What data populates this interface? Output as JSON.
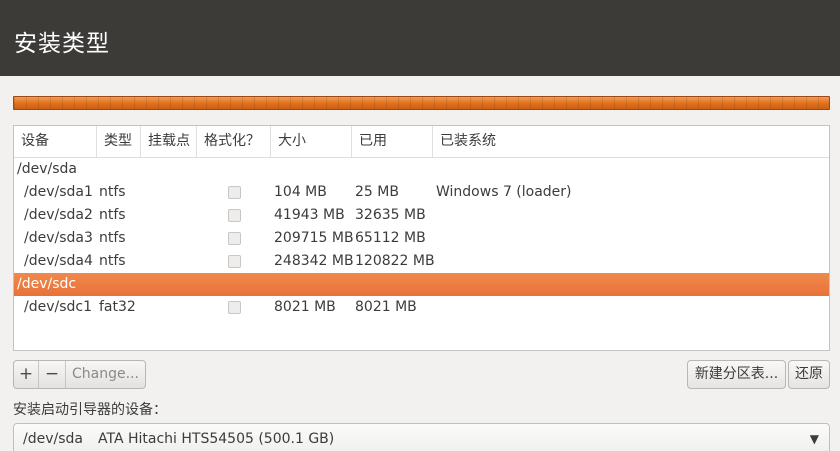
{
  "window": {
    "title": "安装类型"
  },
  "table": {
    "columns": [
      "设备",
      "类型",
      "挂载点",
      "格式化？",
      "大小",
      "已用",
      "已装系统"
    ],
    "rows": [
      {
        "device": "/dev/sda",
        "type": "",
        "mount": "",
        "format": null,
        "size": "",
        "used": "",
        "system": "",
        "indent": false,
        "selected": false
      },
      {
        "device": "/dev/sda1",
        "type": "ntfs",
        "mount": "",
        "format": false,
        "size": "104 MB",
        "used": "25 MB",
        "system": "Windows 7 (loader)",
        "indent": true,
        "selected": false
      },
      {
        "device": "/dev/sda2",
        "type": "ntfs",
        "mount": "",
        "format": false,
        "size": "41943 MB",
        "used": "32635 MB",
        "system": "",
        "indent": true,
        "selected": false
      },
      {
        "device": "/dev/sda3",
        "type": "ntfs",
        "mount": "",
        "format": false,
        "size": "209715 MB",
        "used": "65112 MB",
        "system": "",
        "indent": true,
        "selected": false
      },
      {
        "device": "/dev/sda4",
        "type": "ntfs",
        "mount": "",
        "format": false,
        "size": "248342 MB",
        "used": "120822 MB",
        "system": "",
        "indent": true,
        "selected": false
      },
      {
        "device": "/dev/sdc",
        "type": "",
        "mount": "",
        "format": null,
        "size": "",
        "used": "",
        "system": "",
        "indent": false,
        "selected": true
      },
      {
        "device": "/dev/sdc1",
        "type": "fat32",
        "mount": "",
        "format": false,
        "size": "8021 MB",
        "used": "8021 MB",
        "system": "",
        "indent": true,
        "selected": false
      }
    ]
  },
  "toolbar": {
    "add_label": "+",
    "remove_label": "−",
    "change_label": "Change...",
    "new_table_label": "新建分区表...",
    "revert_label": "还原"
  },
  "bootloader": {
    "label": "安装启动引导器的设备：",
    "device": "/dev/sda",
    "description": "ATA Hitachi HTS54505 (500.1 GB)",
    "arrow": "▼"
  },
  "colors": {
    "titlebar": "#3c3b37",
    "selection": "#e8713a",
    "partition_bar": "#e0701d"
  }
}
